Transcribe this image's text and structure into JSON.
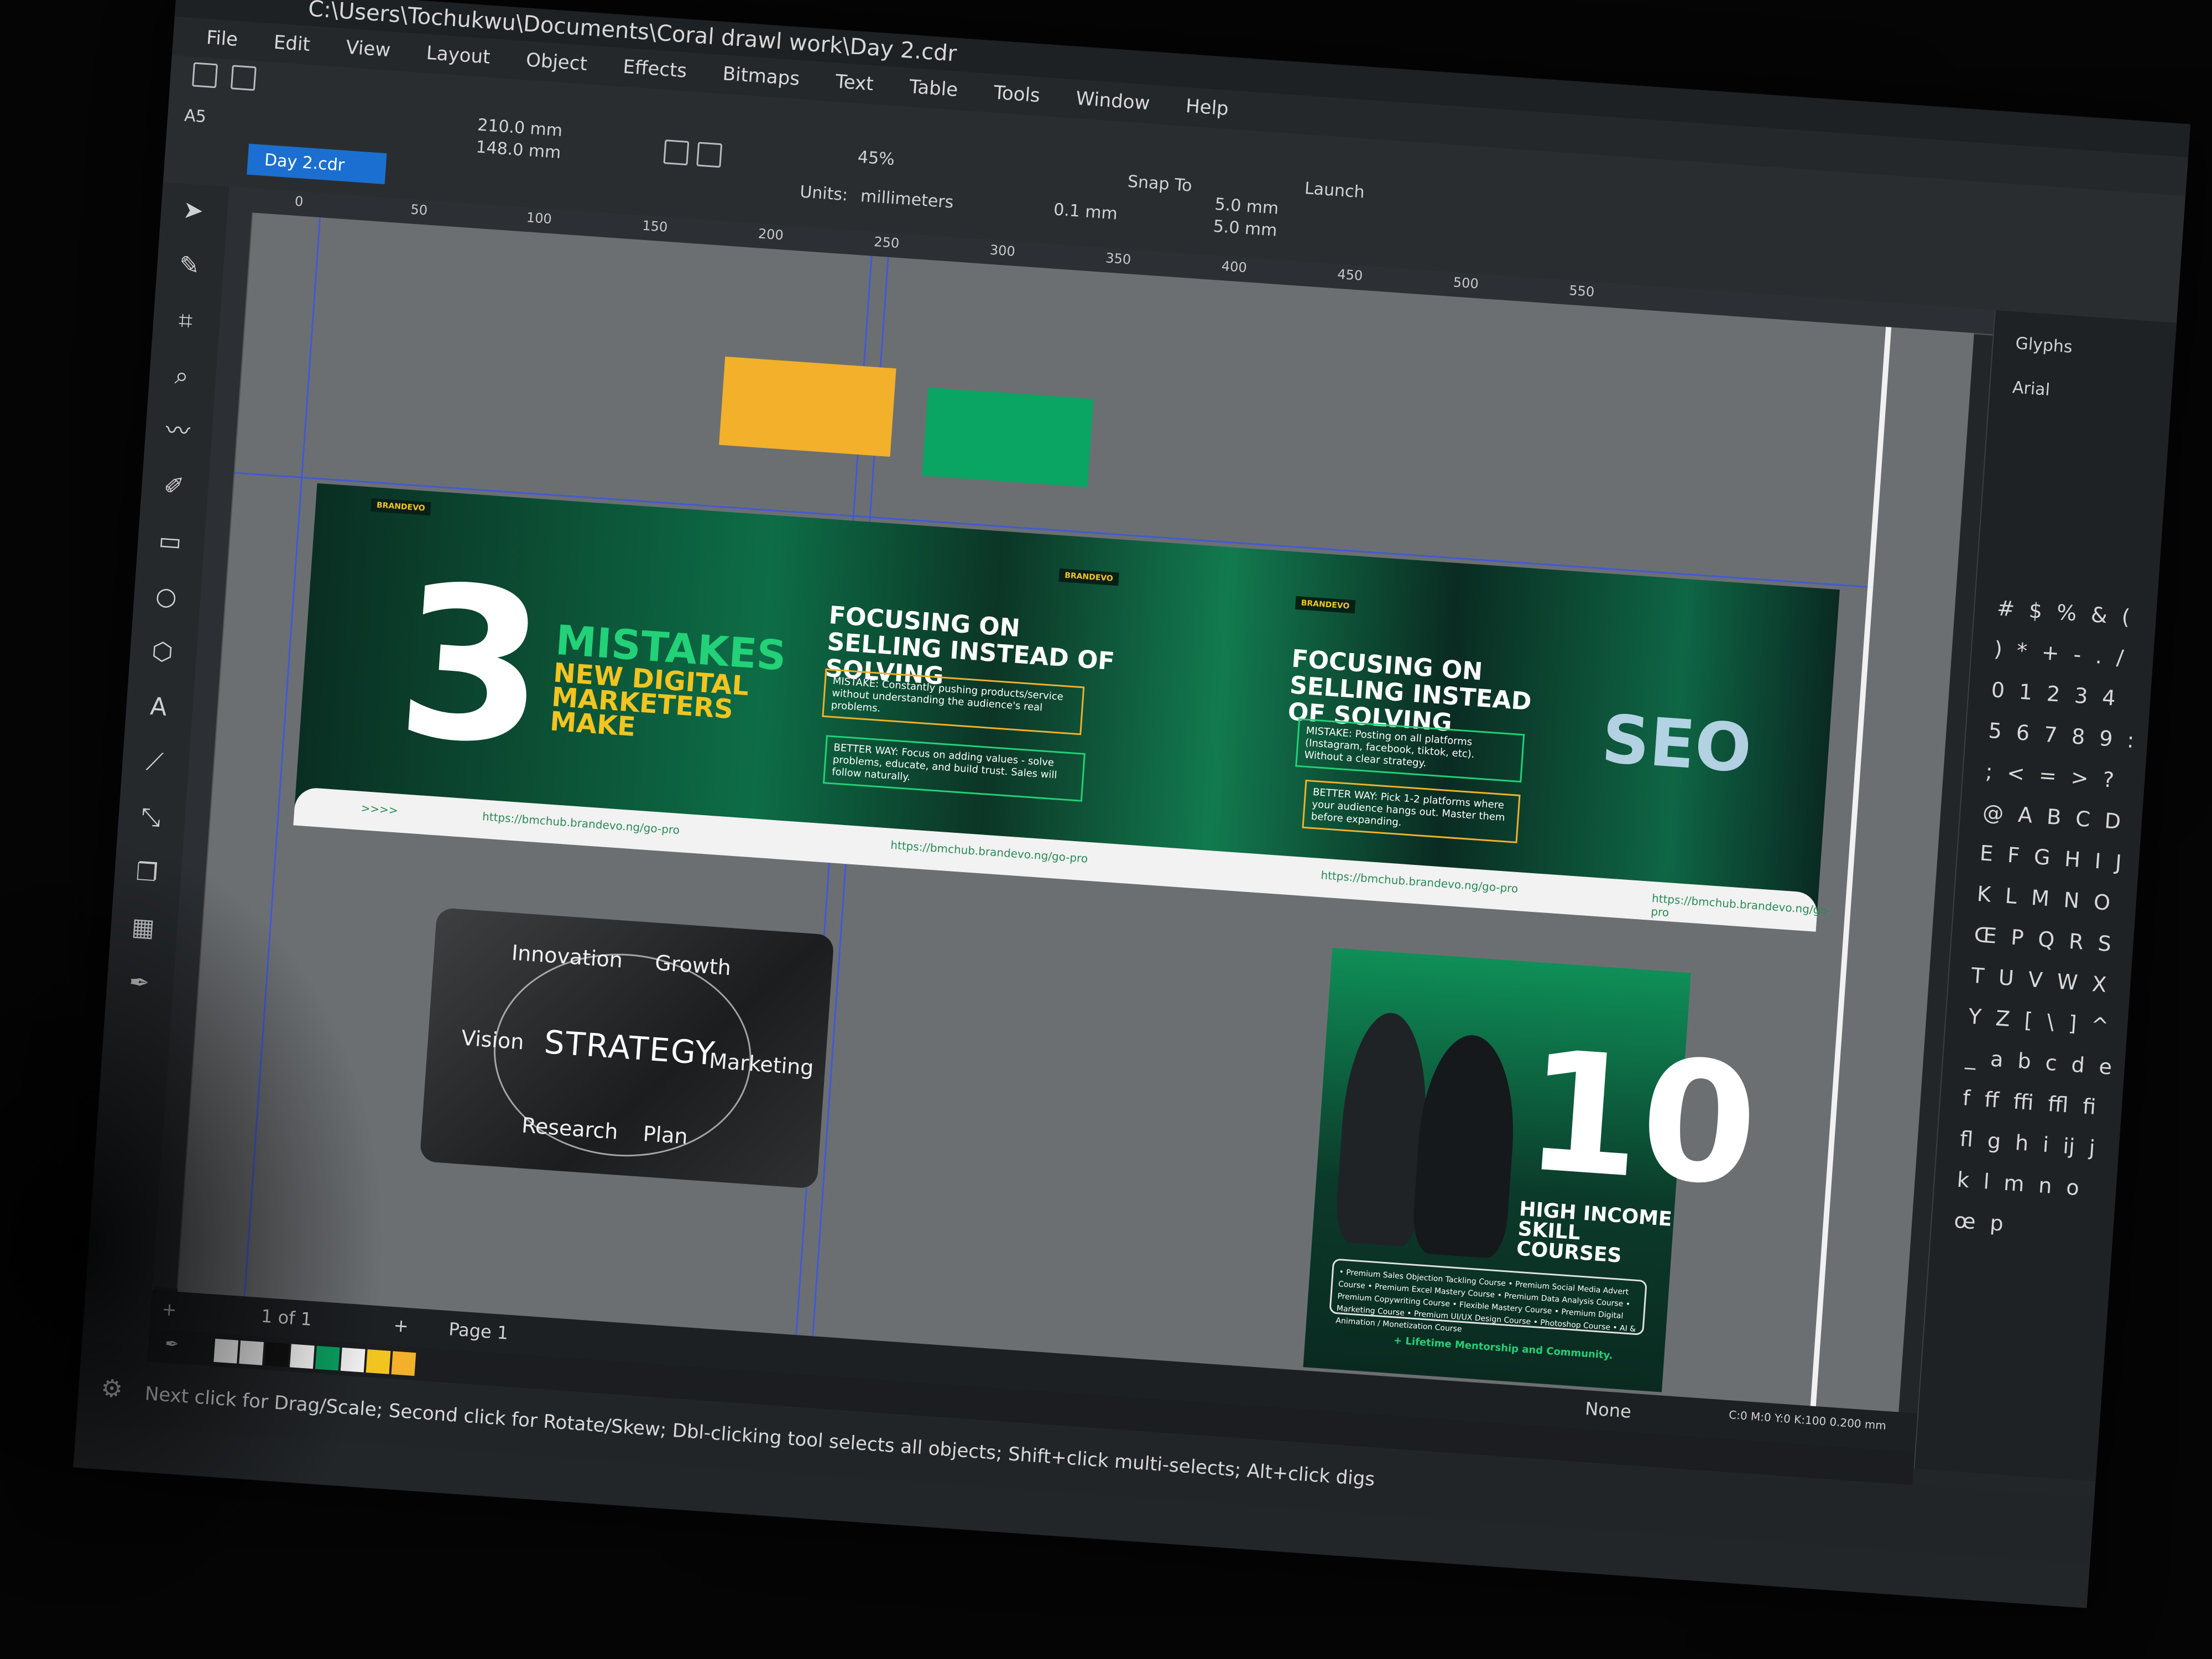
{
  "window": {
    "path": "C:\\Users\\Tochukwu\\Documents\\Coral drawl work\\Day 2.cdr"
  },
  "menu": [
    "File",
    "Edit",
    "View",
    "Layout",
    "Object",
    "Effects",
    "Bitmaps",
    "Text",
    "Table",
    "Tools",
    "Window",
    "Help"
  ],
  "propbar": {
    "page_size": "A5",
    "width": "210.0 mm",
    "height": "148.0 mm",
    "zoom": "45%",
    "units_label": "Units:",
    "units_value": "millimeters",
    "nudge": "0.1 mm",
    "dup_x": "5.0 mm",
    "dup_y": "5.0 mm",
    "snap_to": "Snap To",
    "launch": "Launch"
  },
  "document_tab": "Day 2.cdr",
  "ruler_h": [
    "0",
    "50",
    "100",
    "150",
    "200",
    "250",
    "300",
    "350",
    "400",
    "450",
    "500",
    "550"
  ],
  "designs": {
    "brand": "BRANDEVO",
    "big_number": "3",
    "mistakes": "MISTAKES",
    "mistakes_sub": "NEW DIGITAL MARKETERS MAKE",
    "focus_title": "FOCUSING ON SELLING INSTEAD OF SOLVING",
    "mistake_box_1": "MISTAKE: Constantly pushing products/service without understanding the audience's real problems.",
    "better_box_1": "BETTER WAY: Focus on adding values - solve problems, educate, and build trust. Sales will follow naturally.",
    "mistake_box_2": "MISTAKE: Posting on all platforms (Instagram, facebook, tiktok, etc). Without a clear strategy.",
    "better_box_2": "BETTER WAY: Pick 1-2 platforms where your audience hangs out. Master them before expanding.",
    "seo": "SEO",
    "url": "https://bmchub.brandevo.ng/go-pro",
    "arrows": ">>>>",
    "strategy": "STRATEGY",
    "innovation": "Innovation",
    "growth": "Growth",
    "vision": "Vision",
    "marketing": "Marketing",
    "research": "Research",
    "plan": "Plan",
    "ten": "10",
    "high_income": "HIGH INCOME SKILL COURSES",
    "courses": "• Premium Sales Objection Tackling Course • Premium Social Media Advert Course • Premium Excel Mastery Course • Premium Data Analysis Course • Premium Copywriting Course • Flexible Mastery Course • Premium Digital Marketing Course • Premium UI/UX Design Course • Photoshop Course • AI & Animation / Monetization Course",
    "lifetime": "+ Lifetime Mentorship and Community."
  },
  "glyph_panel": {
    "title": "Glyphs",
    "font": "Arial",
    "glyphs": "# $ % & ( ) * + - . / 0 1 2 3 4 5 6 7 8 9 : ; < = > ? @ A B C D E F G H I J K L M N O Œ P Q R S T U V W X Y Z [ \\ ] ^ _ a b c d e f ff ffi ffl fi fl g h i ij j k l m n o œ p"
  },
  "pager": {
    "count": "1 of 1",
    "page_tab": "Page 1"
  },
  "fill_info": "None",
  "color_info": "C:0 M:0 Y:0 K:100 0.200 mm",
  "palette": [
    "#ffffff",
    "#f2f2f2",
    "#111111",
    "#ffffff",
    "#0aa463",
    "#f2f2f2",
    "#f2c420",
    "#f2b02b"
  ],
  "status_text": "Next click for Drag/Scale; Second click for Rotate/Skew; Dbl-clicking tool selects all objects; Shift+click multi-selects; Alt+click digs",
  "ruler_v_unit": "millimeters"
}
